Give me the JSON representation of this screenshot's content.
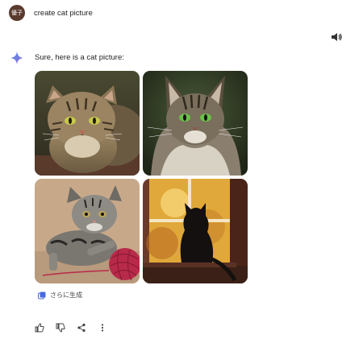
{
  "user": {
    "avatar_text": "優子",
    "prompt": "create cat picture"
  },
  "response": {
    "text": "Sure, here is a cat picture:",
    "images": [
      {
        "name": "cat-image-tabby"
      },
      {
        "name": "cat-image-maine-coon"
      },
      {
        "name": "cat-image-kitten-yarn"
      },
      {
        "name": "cat-image-black-cat-window"
      }
    ],
    "generate_more_label": "さらに生成"
  },
  "icons": {
    "speaker": "speaker-icon",
    "sparkle": "gemini-sparkle-icon",
    "like": "thumbs-up-icon",
    "dislike": "thumbs-down-icon",
    "share": "share-icon",
    "more": "more-vert-icon"
  },
  "colors": {
    "avatar_bg": "#5b3a2e",
    "sparkle": "#4a8af4"
  }
}
